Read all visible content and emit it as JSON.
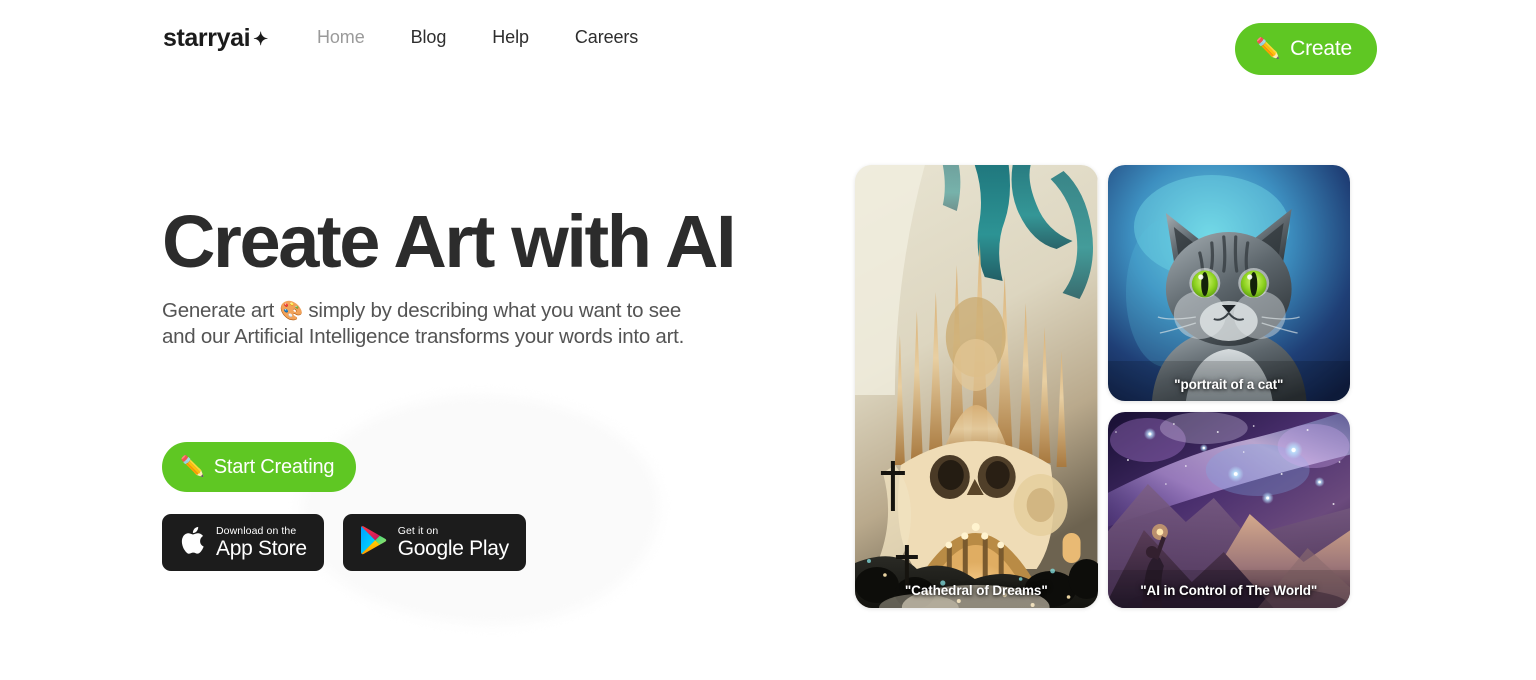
{
  "header": {
    "logo": {
      "text": "starryai",
      "dot": "✦",
      "icon": "starryai-logo"
    },
    "nav": [
      {
        "label": "Home",
        "active": true,
        "name": "nav-link-home"
      },
      {
        "label": "Blog",
        "active": false,
        "name": "nav-link-blog"
      },
      {
        "label": "Help",
        "active": false,
        "name": "nav-link-help"
      },
      {
        "label": "Careers",
        "active": false,
        "name": "nav-link-careers"
      }
    ],
    "create_button": {
      "label": "Create",
      "icon": "✏️"
    }
  },
  "hero": {
    "title": "Create Art with AI",
    "subtitle_part1": "Generate art ",
    "subtitle_emoji": "🎨",
    "subtitle_part2": " simply by describing what you want to see and our Artificial Intelligence transforms your words into art.",
    "cta": {
      "label": "Start Creating",
      "icon": "✏️"
    }
  },
  "store_badges": [
    {
      "name": "app-store-badge",
      "icon": "apple-icon",
      "small_text": "Download on the",
      "big_text": "App Store"
    },
    {
      "name": "google-play-badge",
      "icon": "google-play-icon",
      "small_text": "Get it on",
      "big_text": "Google Play"
    }
  ],
  "gallery": {
    "cards": [
      {
        "caption": "\"Cathedral of Dreams\"",
        "name": "art-card-cathedral"
      },
      {
        "caption": "\"portrait of a cat\"",
        "name": "art-card-cat"
      },
      {
        "caption": "\"AI in Control of The World\"",
        "name": "art-card-ai-world"
      }
    ]
  },
  "colors": {
    "accent_green": "#5fc723",
    "headline": "#2c2c2c",
    "body_text": "#545454",
    "nav_text": "#2e2e2e",
    "nav_muted": "#9a9a9a",
    "badge_bg": "#1c1c1c",
    "page_bg": "#ffffff"
  }
}
